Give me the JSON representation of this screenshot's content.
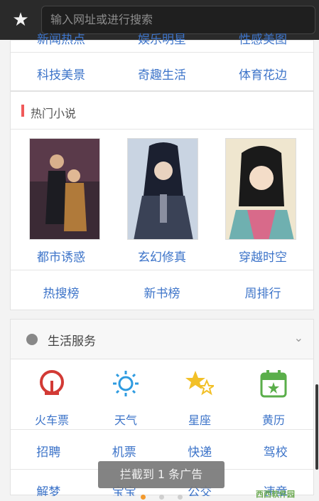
{
  "topbar": {
    "star_icon": "star-icon",
    "url_placeholder": "输入网址或进行搜索"
  },
  "news_card": {
    "partial_row": [
      "新闻热点",
      "娱乐明星",
      "性感美图"
    ],
    "row": [
      "科技美景",
      "奇趣生活",
      "体育花边"
    ]
  },
  "novels": {
    "title": "热门小说",
    "books": [
      "都市诱惑",
      "玄幻修真",
      "穿越时空"
    ],
    "tabs": [
      "热搜榜",
      "新书榜",
      "周排行"
    ]
  },
  "life": {
    "title": "生活服务",
    "services": [
      "火车票",
      "天气",
      "星座",
      "黄历"
    ],
    "row2": [
      "招聘",
      "机票",
      "快递",
      "驾校"
    ],
    "row3": [
      "解梦",
      "宝宝",
      "公交",
      "违章"
    ]
  },
  "toast": "拦截到 1 条广告",
  "watermark": "西西软件园",
  "colors": {
    "link": "#3d74c9",
    "accent_red": "#f05a5a",
    "active_dot": "#f39a2e"
  }
}
